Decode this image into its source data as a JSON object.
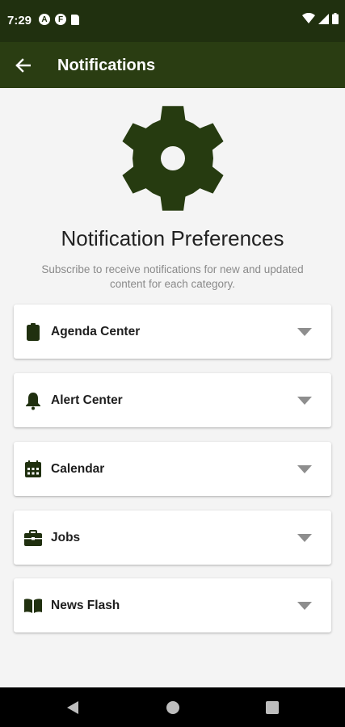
{
  "status_bar": {
    "time": "7:29",
    "left_icons": [
      "notification-a-icon",
      "notification-f-icon",
      "sd-card-icon"
    ],
    "left_icon_letters": [
      "A",
      "F"
    ],
    "right_icons": [
      "wifi-icon",
      "cell-signal-icon",
      "battery-icon"
    ]
  },
  "app_bar": {
    "title": "Notifications",
    "back_icon": "arrow-left-icon"
  },
  "header": {
    "icon": "gear-icon",
    "title": "Notification Preferences",
    "subtitle": "Subscribe to receive notifications for new and updated content for each category."
  },
  "categories": [
    {
      "label": "Agenda Center",
      "icon": "clipboard-icon"
    },
    {
      "label": "Alert Center",
      "icon": "bell-icon"
    },
    {
      "label": "Calendar",
      "icon": "calendar-icon"
    },
    {
      "label": "Jobs",
      "icon": "briefcase-icon"
    },
    {
      "label": "News Flash",
      "icon": "open-book-icon"
    }
  ],
  "nav_bar": {
    "buttons": [
      "back-triangle-icon",
      "home-circle-icon",
      "recents-square-icon"
    ]
  },
  "colors": {
    "status_bar": "#20300f",
    "app_bar": "#2a3d12",
    "accent": "#2a3d12",
    "background": "#f4f4f4",
    "chevron": "#8e8e8e"
  }
}
